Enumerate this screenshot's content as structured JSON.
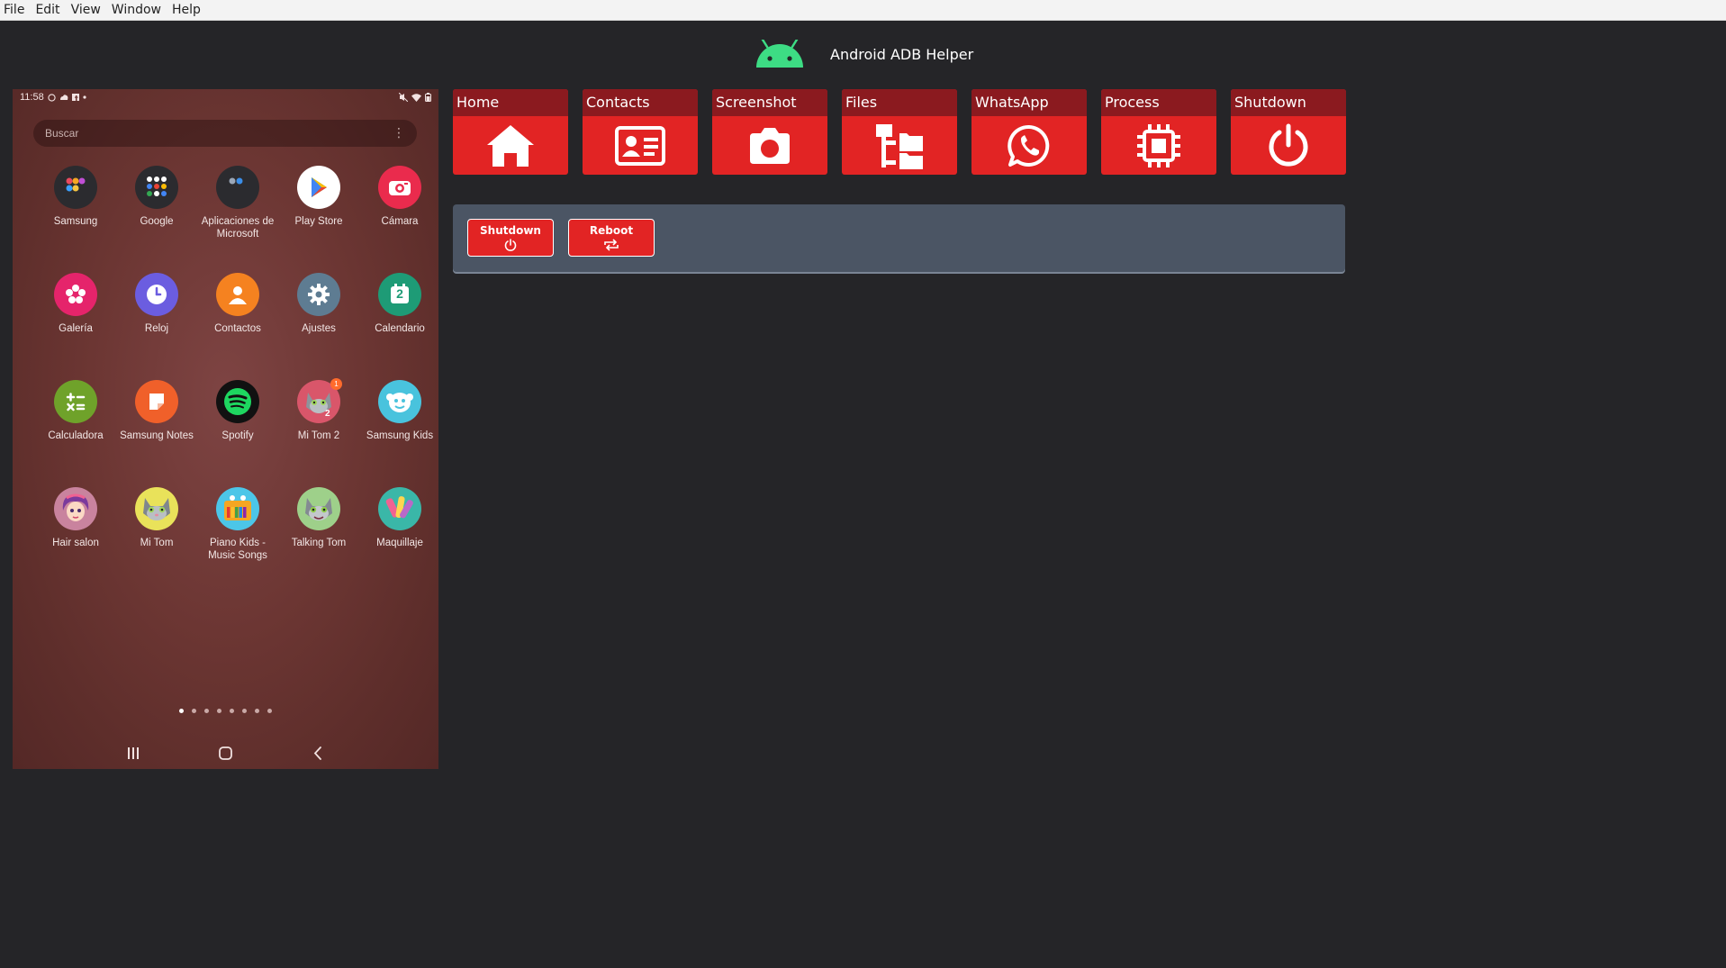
{
  "menubar": {
    "items": [
      "File",
      "Edit",
      "View",
      "Window",
      "Help"
    ]
  },
  "header": {
    "title": "Android ADB Helper",
    "logo_icon": "android-robot-icon",
    "logo_color": "#3ddc84"
  },
  "phone": {
    "status_time": "11:58",
    "search_placeholder": "Buscar",
    "apps": [
      {
        "label": "Samsung",
        "icon": "samsung-folder-icon"
      },
      {
        "label": "Google",
        "icon": "google-folder-icon"
      },
      {
        "label": "Aplicaciones de Microsoft",
        "icon": "microsoft-folder-icon"
      },
      {
        "label": "Play Store",
        "icon": "play-store-icon"
      },
      {
        "label": "Cámara",
        "icon": "camera-icon"
      },
      {
        "label": "Galería",
        "icon": "gallery-icon"
      },
      {
        "label": "Reloj",
        "icon": "clock-icon"
      },
      {
        "label": "Contactos",
        "icon": "contacts-icon"
      },
      {
        "label": "Ajustes",
        "icon": "settings-icon"
      },
      {
        "label": "Calendario",
        "icon": "calendar-icon"
      },
      {
        "label": "Calculadora",
        "icon": "calculator-icon"
      },
      {
        "label": "Samsung Notes",
        "icon": "notes-icon"
      },
      {
        "label": "Spotify",
        "icon": "spotify-icon"
      },
      {
        "label": "Mi Tom 2",
        "icon": "tom2-icon",
        "badge": "1"
      },
      {
        "label": "Samsung Kids",
        "icon": "kids-icon"
      },
      {
        "label": "Hair salon",
        "icon": "hair-salon-icon"
      },
      {
        "label": "Mi Tom",
        "icon": "tom-icon"
      },
      {
        "label": "Piano Kids - Music Songs",
        "icon": "piano-icon"
      },
      {
        "label": "Talking Tom",
        "icon": "talking-tom-icon"
      },
      {
        "label": "Maquillaje",
        "icon": "makeup-icon"
      }
    ],
    "calendar_day": "2"
  },
  "toolbar": {
    "buttons": [
      {
        "label": "Home",
        "icon": "home-icon"
      },
      {
        "label": "Contacts",
        "icon": "contact-card-icon"
      },
      {
        "label": "Screenshot",
        "icon": "camera-icon"
      },
      {
        "label": "Files",
        "icon": "file-tree-icon"
      },
      {
        "label": "WhatsApp",
        "icon": "whatsapp-icon"
      },
      {
        "label": "Process",
        "icon": "cpu-chip-icon"
      },
      {
        "label": "Shutdown",
        "icon": "power-icon"
      }
    ]
  },
  "panel": {
    "shutdown_label": "Shutdown",
    "reboot_label": "Reboot"
  },
  "colors": {
    "accent": "#e22424",
    "accent_dark": "#8b1a1f",
    "panel": "#4b5564",
    "background": "#252528"
  }
}
